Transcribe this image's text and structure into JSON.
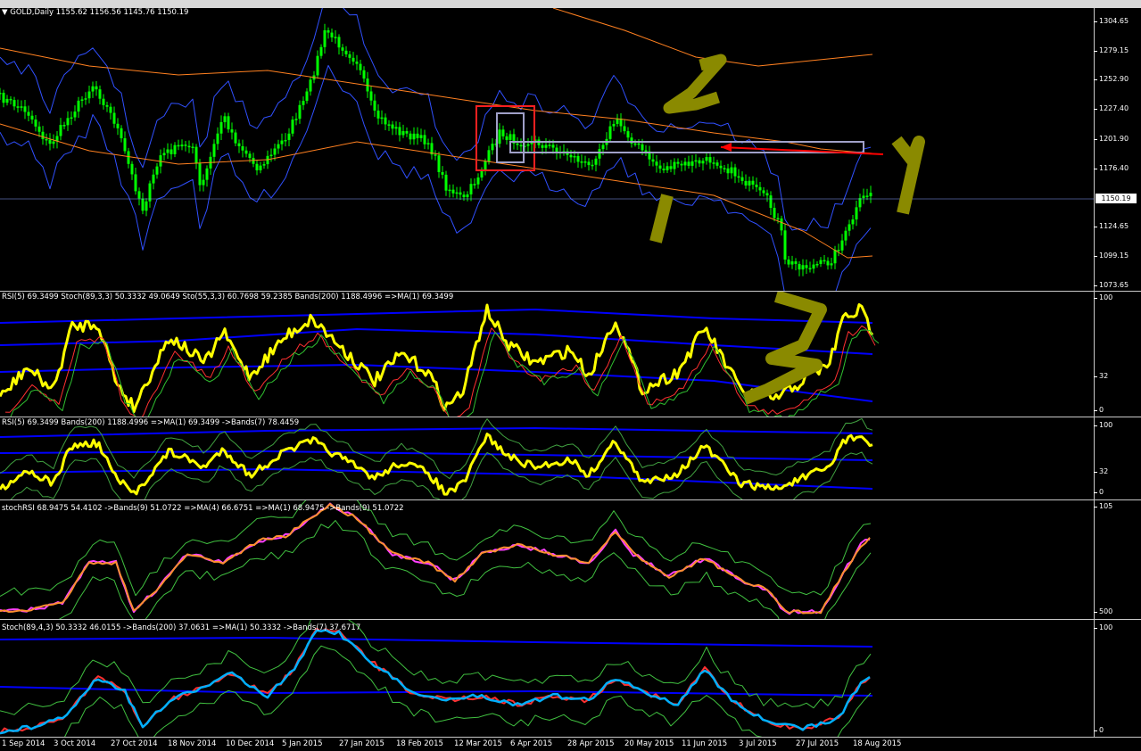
{
  "window": {
    "symbol_caption": "GOLD,Daily"
  },
  "main_pane": {
    "ohlc": "1155.62 1156.56 1145.76 1150.19",
    "price_ticks": [
      "1304.65",
      "1279.15",
      "1252.90",
      "1227.40",
      "1201.90",
      "1176.40",
      "1150.19",
      "1124.65",
      "1099.15",
      "1073.65"
    ],
    "current_price": "1150.19",
    "annotations": [
      "2",
      "1",
      "1",
      "2"
    ]
  },
  "pane1": {
    "label": "RSI(5) 69.3499  Stoch(89,3,3) 50.3332 49.0649  Sto(55,3,3) 60.7698 59.2385  Bands(200) 1188.4996  =>MA(1) 69.3499",
    "ticks": [
      "100",
      "32",
      "0"
    ]
  },
  "pane2": {
    "label": "RSI(5) 69.3499  Bands(200) 1188.4996  =>MA(1) 69.3499  ->Bands(7) 78.4459",
    "ticks": [
      "100",
      "32",
      "0"
    ]
  },
  "pane3": {
    "label": "stochRSI 68.9475 54.4102  ->Bands(9) 51.0722  =>MA(4) 66.6751  =>MA(1) 68.9475  ->Bands(9) 51.0722",
    "ticks": [
      "105",
      "500"
    ]
  },
  "pane4": {
    "label": "Stoch(89,4,3) 50.3332 46.0155  ->Bands(200) 37.0631  =>MA(1) 50.3332  ->Bands(7) 37.6717",
    "ticks": [
      "100",
      "0"
    ]
  },
  "time_axis": [
    "1 Sep 2014",
    "3 Oct 2014",
    "27 Oct 2014",
    "18 Nov 2014",
    "10 Dec 2014",
    "5 Jan 2015",
    "27 Jan 2015",
    "18 Feb 2015",
    "12 Mar 2015",
    "6 Apr 2015",
    "28 Apr 2015",
    "20 May 2015",
    "11 Jun 2015",
    "3 Jul 2015",
    "27 Jul 2015",
    "18 Aug 2015"
  ],
  "colors": {
    "candle": "#00ff00",
    "bb": "#3050ff",
    "ma": "#ff8020",
    "rsi": "#ffff00",
    "band": "#0000ff",
    "stoch": "#ff0000",
    "stochfast": "#00b0ff",
    "annot": "#8a8a00"
  }
}
